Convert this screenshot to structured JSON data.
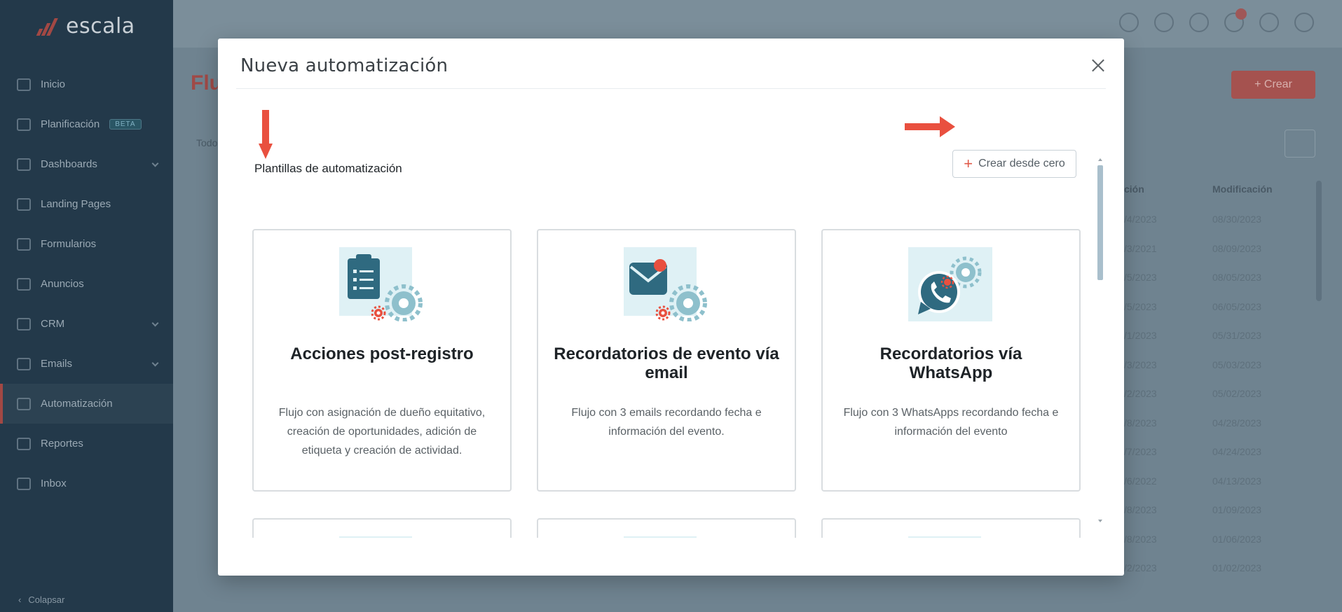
{
  "app": {
    "logo_text": "escala",
    "brand_color": "#e15a48"
  },
  "sidebar": {
    "items": [
      {
        "label": "Inicio",
        "icon": "home-icon"
      },
      {
        "label": "Planificación",
        "icon": "filter-icon",
        "badge": "BETA"
      },
      {
        "label": "Dashboards",
        "icon": "dashboard-icon"
      },
      {
        "label": "Landing Pages",
        "icon": "landing-icon"
      },
      {
        "label": "Formularios",
        "icon": "form-icon"
      },
      {
        "label": "Anuncios",
        "icon": "ads-icon"
      },
      {
        "label": "CRM",
        "icon": "crm-icon"
      },
      {
        "label": "Emails",
        "icon": "mail-icon"
      },
      {
        "label": "Automatización",
        "icon": "automation-icon"
      },
      {
        "label": "Reportes",
        "icon": "reports-icon"
      },
      {
        "label": "Inbox",
        "icon": "inbox-icon"
      }
    ],
    "collapse_label": "Colapsar"
  },
  "background": {
    "page_title": "Flu",
    "crear_label": "+ Crear",
    "tab_label": "Todos",
    "col_header_1": "ción",
    "col_header_2": "Modificación",
    "col1_values": [
      "/4/2023",
      "/3/2021",
      "/5/2023",
      "/5/2023",
      "/1/2023",
      "/3/2023",
      "/2/2023",
      "/8/2023",
      "/7/2023",
      "/6/2022",
      "/8/2023",
      "/8/2023",
      "/2/2023"
    ],
    "col2_values": [
      "08/30/2023",
      "08/09/2023",
      "08/05/2023",
      "06/05/2023",
      "05/31/2023",
      "05/03/2023",
      "05/02/2023",
      "04/28/2023",
      "04/24/2023",
      "04/13/2023",
      "01/09/2023",
      "01/06/2023",
      "01/02/2023"
    ]
  },
  "modal": {
    "title": "Nueva automatización",
    "section_title": "Plantillas de automatización",
    "create_from_scratch_label": "Crear desde cero",
    "templates": [
      {
        "title": "Acciones post-registro",
        "description": "Flujo con asignación de dueño equitativo, creación de oportunidades, adición de etiqueta y creación de actividad.",
        "icon": "clipboard-gear-icon"
      },
      {
        "title": "Recordatorios de evento vía email",
        "description": "Flujo con 3 emails recordando fecha e información del evento.",
        "icon": "email-gear-icon"
      },
      {
        "title": "Recordatorios vía WhatsApp",
        "description": "Flujo con 3 WhatsApps recordando fecha e información del evento",
        "icon": "whatsapp-gear-icon"
      },
      {
        "title": "",
        "description": "",
        "icon": "lightbulb-person-icon"
      },
      {
        "title": "",
        "description": "",
        "icon": "email-download-icon"
      },
      {
        "title": "",
        "description": "",
        "icon": "phone-notification-icon"
      }
    ]
  },
  "colors": {
    "accent_red": "#e9503f",
    "illustration_bg": "#dff1f5",
    "illustration_dark": "#2f6a80",
    "gear_light": "#8ec0cc"
  }
}
